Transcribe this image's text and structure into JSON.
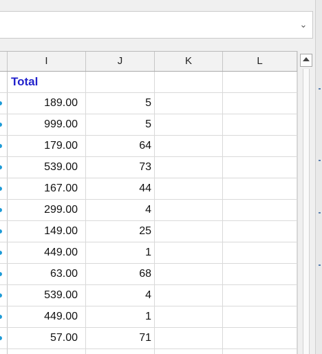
{
  "combo": {
    "value": "",
    "arrow_icon": "chevron-down-icon"
  },
  "columns": [
    "I",
    "J",
    "K",
    "L"
  ],
  "header_row": {
    "I": "Total",
    "J": "",
    "K": "",
    "L": ""
  },
  "rows": [
    {
      "I": "189.00",
      "J": "5"
    },
    {
      "I": "999.00",
      "J": "5"
    },
    {
      "I": "179.00",
      "J": "64"
    },
    {
      "I": "539.00",
      "J": "73"
    },
    {
      "I": "167.00",
      "J": "44"
    },
    {
      "I": "299.00",
      "J": "4"
    },
    {
      "I": "149.00",
      "J": "25"
    },
    {
      "I": "449.00",
      "J": "1"
    },
    {
      "I": "63.00",
      "J": "68"
    },
    {
      "I": "539.00",
      "J": "4"
    },
    {
      "I": "449.00",
      "J": "1"
    },
    {
      "I": "57.00",
      "J": "71"
    }
  ],
  "colors": {
    "total_label": "#2222cc",
    "row_marker": "#1e9bd7"
  }
}
